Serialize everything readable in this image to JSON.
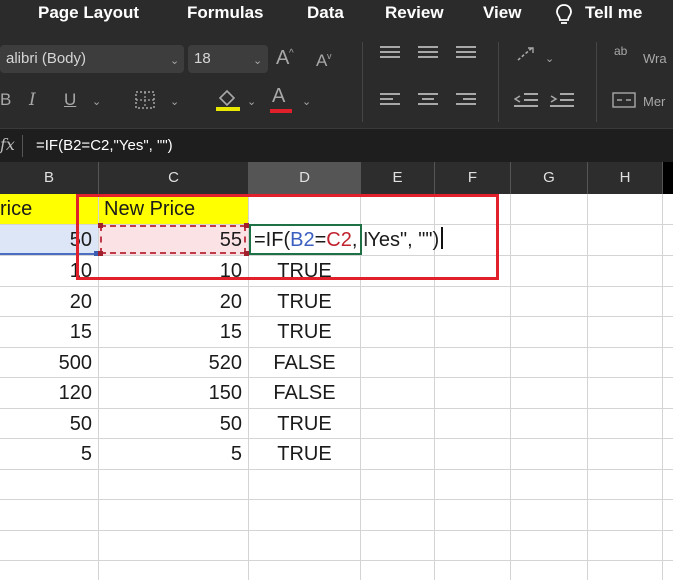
{
  "menu": {
    "tabs": [
      "Page Layout",
      "Formulas",
      "Data",
      "Review",
      "View"
    ],
    "tell_me": "Tell me",
    "bulb_icon": "lightbulb-icon"
  },
  "ribbon": {
    "font_name": "alibri (Body)",
    "font_size": "18",
    "grow_font": "A",
    "shrink_font": "A",
    "italic": "I",
    "underline": "U",
    "font_color_letter": "A",
    "wrap_label": "Wra",
    "merge_label": "Mer",
    "ab_label": "ab",
    "fill_color": "#e8e800",
    "font_color": "#e0202a"
  },
  "formula_bar": {
    "fx": "fx",
    "formula": "=IF(B2=C2,\"Yes\", \"\")"
  },
  "columns": [
    "B",
    "C",
    "D",
    "E",
    "F",
    "G",
    "H"
  ],
  "active_column": "D",
  "header_row": {
    "b": "rice",
    "c": "New Price"
  },
  "rows": [
    {
      "b": "50",
      "c": "55",
      "d": ""
    },
    {
      "b": "10",
      "c": "10",
      "d": "TRUE"
    },
    {
      "b": "20",
      "c": "20",
      "d": "TRUE"
    },
    {
      "b": "15",
      "c": "15",
      "d": "TRUE"
    },
    {
      "b": "500",
      "c": "520",
      "d": "FALSE"
    },
    {
      "b": "120",
      "c": "150",
      "d": "FALSE"
    },
    {
      "b": "50",
      "c": "50",
      "d": "TRUE"
    },
    {
      "b": "5",
      "c": "5",
      "d": "TRUE"
    }
  ],
  "edit_cell": {
    "prefix": "=IF(",
    "ref1": "B2",
    "eq": "=",
    "ref2": "C2",
    "comma": ",",
    "suffix": "Yes\", \"\")",
    "ibeam_icon": "text-cursor-icon"
  },
  "colors": {
    "header_yellow": "#ffff00",
    "ref_b_blue": "#3b5fc0",
    "ref_c_red": "#c0222e",
    "annotation_red": "#e0202a",
    "selected_green": "#1e7145"
  }
}
